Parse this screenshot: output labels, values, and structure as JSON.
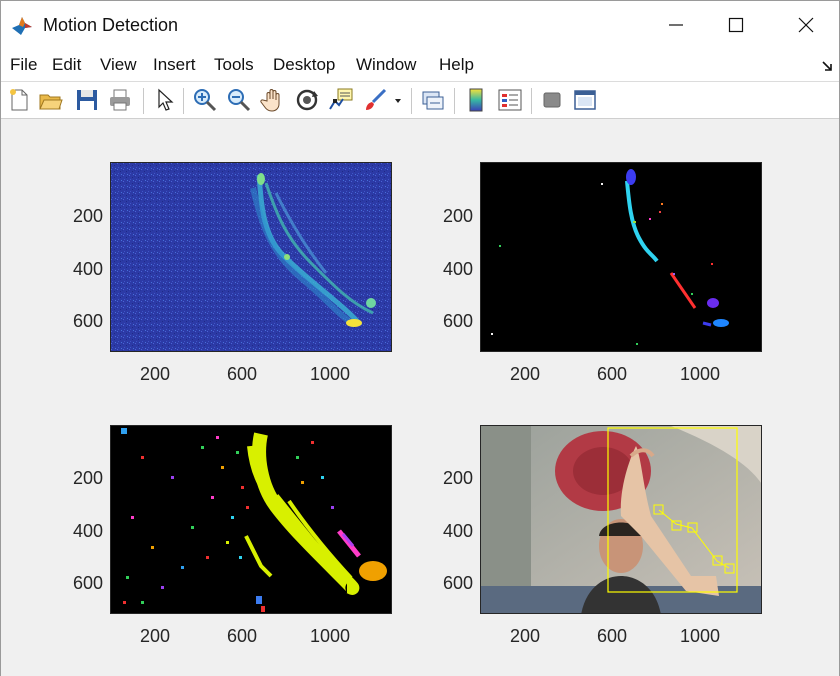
{
  "window": {
    "title": "Motion Detection",
    "app_icon": "matlab-logo-icon",
    "controls": [
      "minimize-icon",
      "maximize-icon",
      "close-icon"
    ]
  },
  "menu": {
    "items": [
      "File",
      "Edit",
      "View",
      "Insert",
      "Tools",
      "Desktop",
      "Window",
      "Help"
    ],
    "dock_arrow": "undock-arrow-icon"
  },
  "toolbar": {
    "buttons": [
      "new-figure-icon",
      "open-file-icon",
      "save-icon",
      "print-icon",
      "edit-plot-arrow-icon",
      "zoom-in-icon",
      "zoom-out-icon",
      "pan-hand-icon",
      "rotate-3d-icon",
      "data-cursor-icon",
      "brush-icon",
      "brush-dropdown-icon",
      "link-plot-icon",
      "insert-colorbar-icon",
      "insert-legend-icon",
      "hide-plot-tools-icon",
      "show-plot-tools-icon"
    ]
  },
  "axes": {
    "yticks": [
      "200",
      "400",
      "600"
    ],
    "xticks": [
      "200",
      "600",
      "1000"
    ],
    "panels": [
      {
        "name": "motion-magnitude-heatmap",
        "y_ticks": [
          "200",
          "400",
          "600"
        ],
        "x_ticks": [
          "200",
          "600",
          "1000"
        ]
      },
      {
        "name": "segmented-motion-labels",
        "y_ticks": [
          "200",
          "400",
          "600"
        ],
        "x_ticks": [
          "200",
          "600",
          "1000"
        ]
      },
      {
        "name": "clustered-motion-labels",
        "y_ticks": [
          "200",
          "400",
          "600"
        ],
        "x_ticks": [
          "200",
          "600",
          "1000"
        ]
      },
      {
        "name": "camera-frame-with-tracking",
        "y_ticks": [
          "200",
          "400",
          "600"
        ],
        "x_ticks": [
          "200",
          "600",
          "1000"
        ]
      }
    ],
    "x_range": [
      0,
      1280
    ],
    "y_range": [
      0,
      720
    ]
  },
  "colors": {
    "window_bg": "#f0f0f0",
    "heatmap_bg": "#2b3ba8",
    "heatmap_hot": "#f5e23a",
    "label_bg": "#000000",
    "tracking_box": "#ffff00"
  }
}
